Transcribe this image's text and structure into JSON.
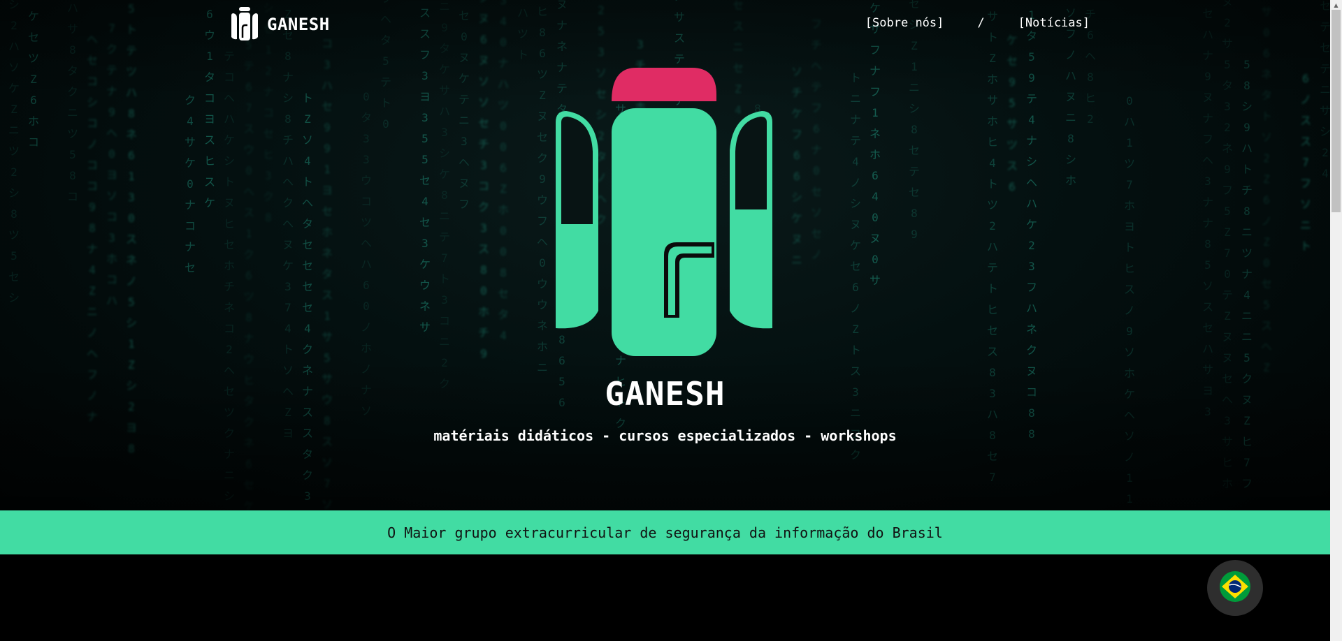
{
  "brand": {
    "name": "GANESH",
    "logo_icon": "ganesh-logo-icon"
  },
  "nav": {
    "links": [
      {
        "label": "[Sobre nós]"
      },
      {
        "label": "[Notícias]"
      }
    ],
    "separator": "/"
  },
  "hero": {
    "title": "GANESH",
    "subtitle": "matériais didáticos - cursos especializados - workshops",
    "background": "matrix-code-rain"
  },
  "banner": {
    "text": "O Maior grupo extracurricular de segurança da informação do Brasil"
  },
  "language_button": {
    "icon": "brazil-flag-icon"
  },
  "colors": {
    "accent": "#42dca3",
    "logo_cap": "#e02c64",
    "background": "#000000",
    "rain": "#1f8f7a"
  }
}
